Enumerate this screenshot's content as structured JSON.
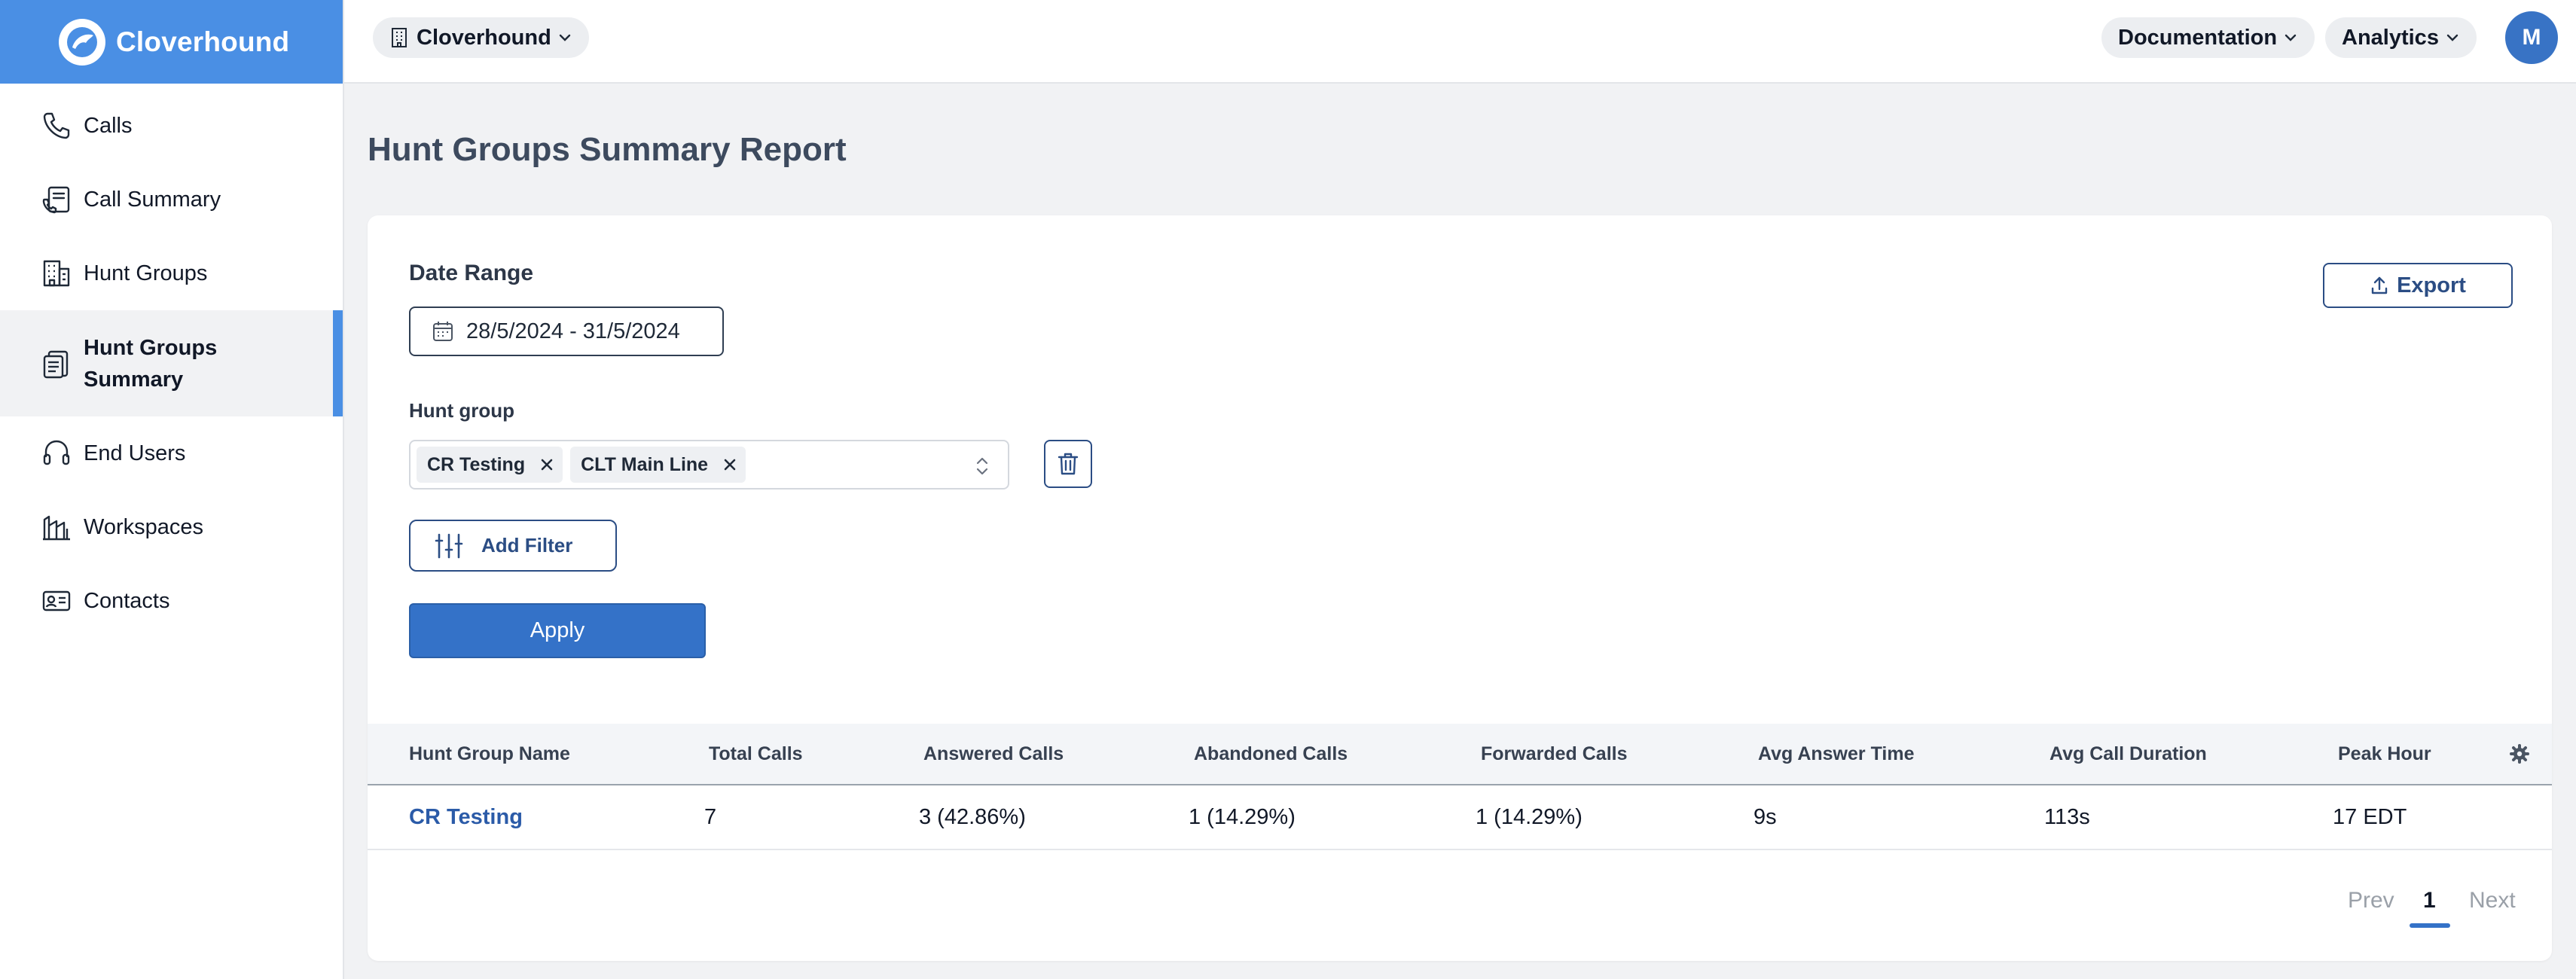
{
  "brand": {
    "name": "Cloverhound"
  },
  "sidebar": {
    "items": [
      {
        "label": "Calls",
        "icon": "phone-icon"
      },
      {
        "label": "Call Summary",
        "icon": "call-summary-icon"
      },
      {
        "label": "Hunt Groups",
        "icon": "building-icon"
      },
      {
        "label": "Hunt Groups Summary",
        "icon": "clipboard-icon",
        "active": true
      },
      {
        "label": "End Users",
        "icon": "headset-icon"
      },
      {
        "label": "Workspaces",
        "icon": "workspace-icon"
      },
      {
        "label": "Contacts",
        "icon": "contact-card-icon"
      }
    ]
  },
  "topbar": {
    "org_selector": "Cloverhound",
    "documentation": "Documentation",
    "analytics": "Analytics",
    "avatar_initial": "M"
  },
  "page": {
    "title": "Hunt Groups Summary Report"
  },
  "filters": {
    "date_range_label": "Date Range",
    "date_range_value": "28/5/2024 - 31/5/2024",
    "hunt_group_label": "Hunt group",
    "selected_groups": [
      "CR Testing",
      "CLT Main Line"
    ],
    "add_filter_label": "Add Filter",
    "apply_label": "Apply",
    "export_label": "Export"
  },
  "table": {
    "headers": [
      "Hunt Group Name",
      "Total Calls",
      "Answered Calls",
      "Abandoned Calls",
      "Forwarded Calls",
      "Avg Answer Time",
      "Avg Call Duration",
      "Peak Hour"
    ],
    "rows": [
      [
        "CR Testing",
        "7",
        "3 (42.86%)",
        "1 (14.29%)",
        "1 (14.29%)",
        "9s",
        "113s",
        "17 EDT"
      ]
    ]
  },
  "pagination": {
    "prev": "Prev",
    "current": "1",
    "next": "Next"
  },
  "colors": {
    "accent": "#4a8fe4",
    "primary_button": "#3472c8",
    "link": "#2b5ba8"
  }
}
